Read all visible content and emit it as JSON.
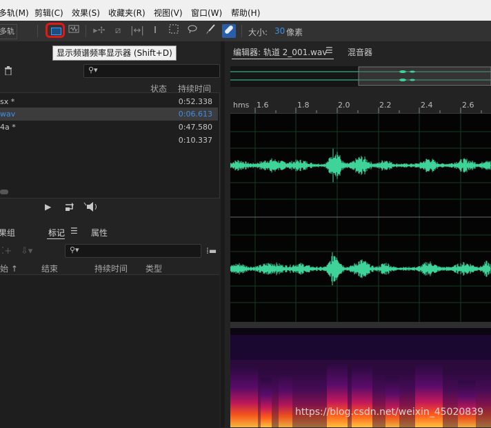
{
  "menu": [
    "多轨(M)",
    "剪辑(C)",
    "效果(S)",
    "收藏夹(R)",
    "视图(V)",
    "窗口(W)",
    "帮助(H)"
  ],
  "toolbar": {
    "multitrack_label": "多轨",
    "size_label": "大小:",
    "size_value": "30",
    "size_unit": "像素",
    "tooltip": "显示频谱频率显示器 (Shift+D)"
  },
  "files_panel": {
    "col_status": "状态",
    "col_duration": "持续时间",
    "rows": [
      {
        "name": "sx *",
        "duration": "0:52.338",
        "selected": false
      },
      {
        "name": "wav",
        "duration": "0:06.613",
        "selected": true
      },
      {
        "name": "4a *",
        "duration": "0:47.580",
        "selected": false
      },
      {
        "name": "",
        "duration": "0:10.337",
        "selected": false
      }
    ]
  },
  "lower_panel": {
    "tabs": [
      "效果组",
      "标记",
      "属性"
    ],
    "active_tab": "标记",
    "columns": [
      "开始",
      "结束",
      "持续时间",
      "类型"
    ]
  },
  "editor": {
    "tab_label": "编辑器: 轨道 2_001.wav",
    "mixer_label": "混音器",
    "ruler_unit": "hms",
    "ruler_ticks": [
      "1.6",
      "1.8",
      "2.0",
      "2.2",
      "2.4",
      "2.6"
    ]
  },
  "watermark": "https://blog.csdn.net/weixin_45020839",
  "colors": {
    "accent": "#3e8ee8",
    "waveform": "#3fd39a",
    "highlight_box": "#e01818"
  }
}
